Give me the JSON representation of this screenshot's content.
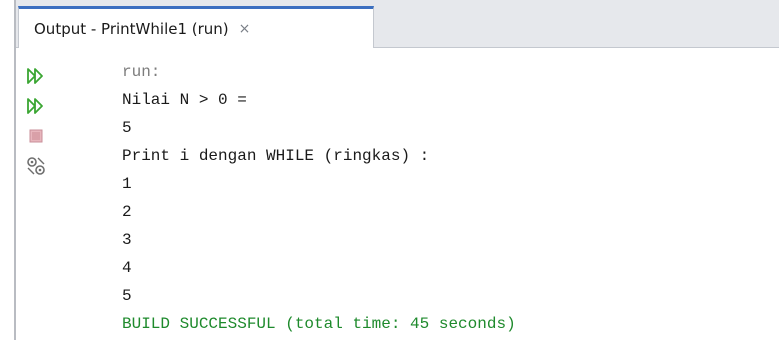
{
  "output_tab": {
    "title": "Output - PrintWhile1 (run)",
    "close_glyph": "×"
  },
  "toolbar": {
    "buttons": [
      {
        "icon": "rerun-icon",
        "color": "#3aa632"
      },
      {
        "icon": "rerun-with-options-icon",
        "color": "#3aa632"
      },
      {
        "icon": "stop-icon",
        "color": "#d9a0a8"
      },
      {
        "icon": "settings-icon",
        "color": "#6e6e6e"
      }
    ]
  },
  "console": {
    "lines": [
      "run:",
      "Nilai N > 0 =",
      "5",
      "Print i dengan WHILE (ringkas) :",
      "1",
      "2",
      "3",
      "4",
      "5",
      "BUILD SUCCESSFUL (total time: 45 seconds)"
    ],
    "colors": {
      "run": "#7d7d7d",
      "normal": "#1a1a1a",
      "success": "#1e8a2c"
    }
  }
}
